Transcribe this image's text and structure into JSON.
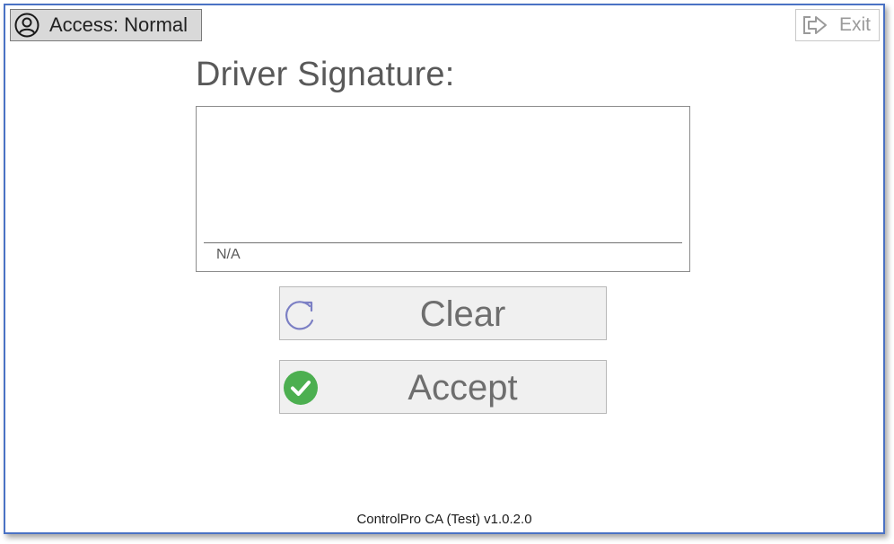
{
  "header": {
    "access_label": "Access: Normal",
    "access_icon": "user-circle-icon",
    "exit_label": "Exit",
    "exit_icon": "exit-arrow-icon"
  },
  "signature": {
    "title": "Driver Signature:",
    "name_text": "N/A"
  },
  "actions": {
    "clear_label": "Clear",
    "clear_icon": "refresh-icon",
    "accept_label": "Accept",
    "accept_icon": "check-circle-icon"
  },
  "footer": {
    "version_text": "ControlPro CA (Test) v1.0.2.0"
  },
  "colors": {
    "window_border": "#4a72c4",
    "access_bg": "#d9d9d9",
    "clear_icon": "#7b7fc4",
    "accept_icon": "#4caf50",
    "button_bg": "#f0f0f0"
  }
}
